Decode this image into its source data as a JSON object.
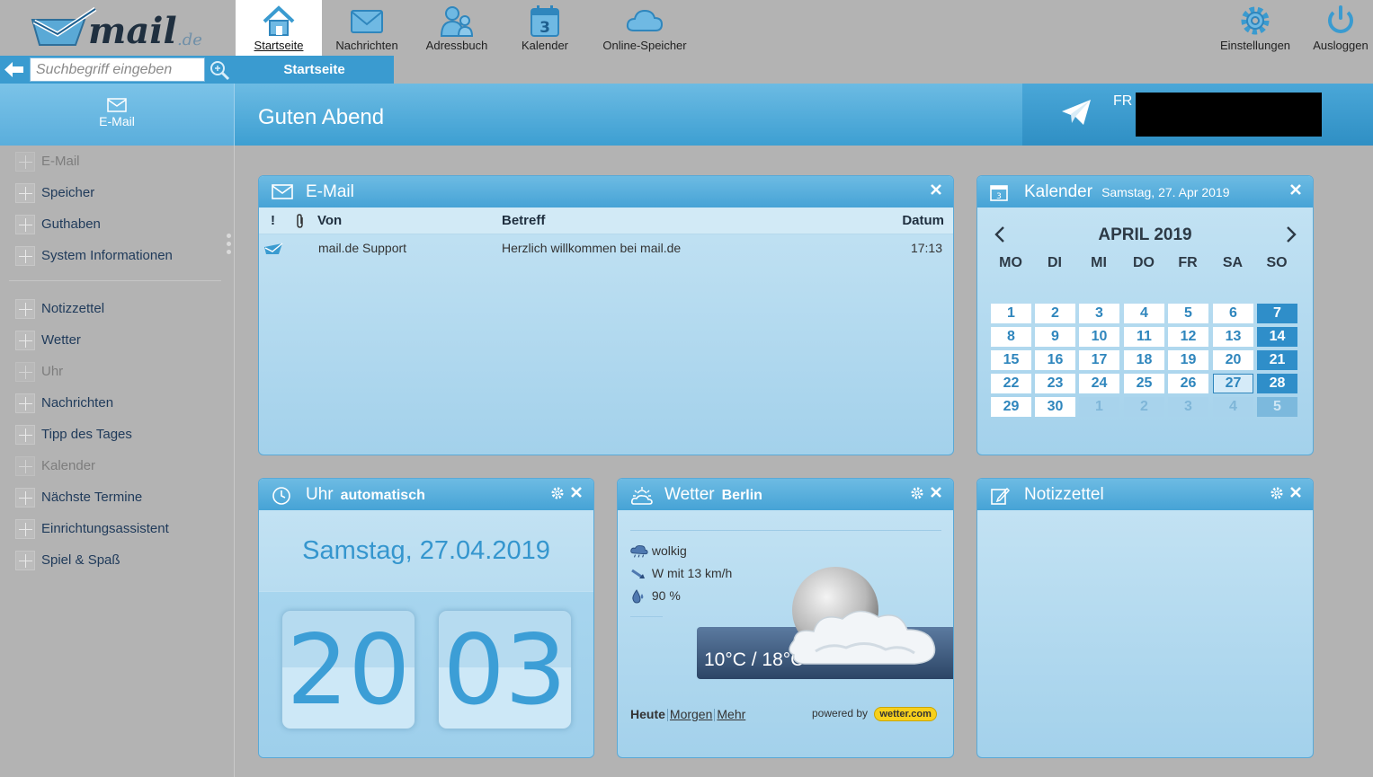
{
  "app": {
    "logo_text": "mail",
    "logo_suffix": ".de"
  },
  "nav": {
    "items": [
      {
        "label": "Startseite",
        "icon": "home-icon"
      },
      {
        "label": "Nachrichten",
        "icon": "envelope-icon"
      },
      {
        "label": "Adressbuch",
        "icon": "contacts-icon"
      },
      {
        "label": "Kalender",
        "icon": "calendar-icon"
      },
      {
        "label": "Online-Speicher",
        "icon": "cloud-icon"
      }
    ],
    "right": [
      {
        "label": "Einstellungen",
        "icon": "gear-icon"
      },
      {
        "label": "Ausloggen",
        "icon": "power-icon"
      }
    ]
  },
  "search": {
    "placeholder": "Suchbegriff eingeben"
  },
  "subtab": {
    "label": "Startseite"
  },
  "side_head": {
    "label": "E-Mail"
  },
  "greeting": "Guten Abend",
  "send_box": {
    "label": "FR"
  },
  "sidebar": {
    "items": [
      {
        "label": "E-Mail",
        "dim": true
      },
      {
        "label": "Speicher",
        "dim": false
      },
      {
        "label": "Guthaben",
        "dim": false
      },
      {
        "label": "System Informationen",
        "dim": false
      },
      {
        "label": "Notizzettel",
        "dim": false
      },
      {
        "label": "Wetter",
        "dim": false
      },
      {
        "label": "Uhr",
        "dim": true
      },
      {
        "label": "Nachrichten",
        "dim": false
      },
      {
        "label": "Tipp des Tages",
        "dim": false
      },
      {
        "label": "Kalender",
        "dim": true
      },
      {
        "label": "Nächste Termine",
        "dim": false
      },
      {
        "label": "Einrichtungsassistent",
        "dim": false
      },
      {
        "label": "Spiel & Spaß",
        "dim": false
      }
    ]
  },
  "email_widget": {
    "title": "E-Mail",
    "columns": {
      "flag": "!",
      "from": "Von",
      "subject": "Betreff",
      "date": "Datum"
    },
    "rows": [
      {
        "from": "mail.de Support",
        "subject": "Herzlich willkommen bei mail.de",
        "date": "17:13"
      }
    ]
  },
  "calendar_widget": {
    "title": "Kalender",
    "subtitle": "Samstag, 27. Apr 2019",
    "month": "APRIL 2019",
    "dow": [
      "MO",
      "DI",
      "MI",
      "DO",
      "FR",
      "SA",
      "SO"
    ],
    "weeks": [
      [
        "1",
        "2",
        "3",
        "4",
        "5",
        "6",
        "7"
      ],
      [
        "8",
        "9",
        "10",
        "11",
        "12",
        "13",
        "14"
      ],
      [
        "15",
        "16",
        "17",
        "18",
        "19",
        "20",
        "21"
      ],
      [
        "22",
        "23",
        "24",
        "25",
        "26",
        "27",
        "28"
      ],
      [
        "29",
        "30",
        "1",
        "2",
        "3",
        "4",
        "5"
      ]
    ],
    "today": "27"
  },
  "clock_widget": {
    "title": "Uhr",
    "mode": "automatisch",
    "date": "Samstag, 27.04.2019",
    "hours": "20",
    "minutes": "03"
  },
  "weather_widget": {
    "title": "Wetter",
    "city": "Berlin",
    "condition": "wolkig",
    "wind": "W mit 13 km/h",
    "humidity": "90 %",
    "temp": "10°C / 18°C",
    "links": {
      "today": "Heute",
      "tomorrow": "Morgen",
      "more": "Mehr"
    },
    "powered_by": "powered by",
    "provider": "wetter.com"
  },
  "notes_widget": {
    "title": "Notizzettel"
  }
}
